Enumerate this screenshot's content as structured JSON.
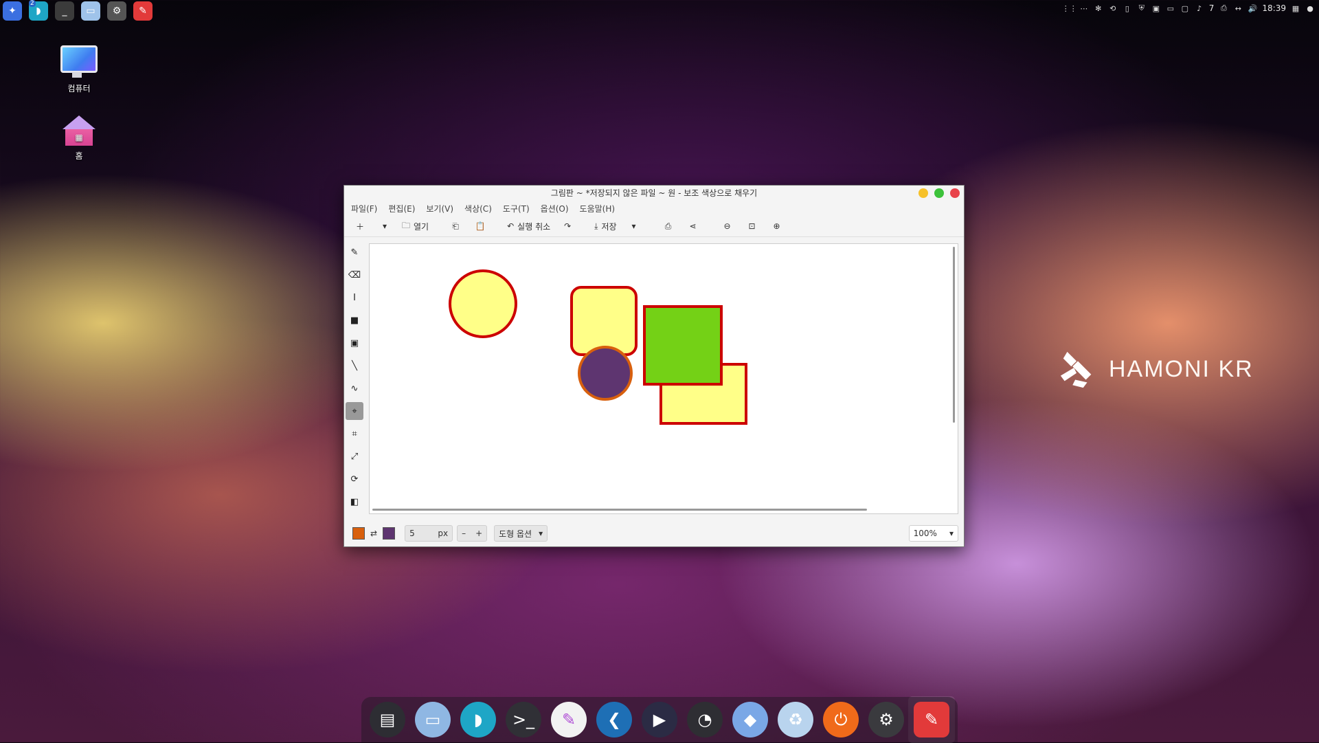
{
  "top_panel": {
    "apps": [
      {
        "name": "hamonikr-icon",
        "color": "#3b6fe0",
        "glyph": "✦"
      },
      {
        "name": "whale-browser-icon",
        "color": "#1ea6c6",
        "glyph": "◗",
        "badge": "2"
      },
      {
        "name": "terminal-icon",
        "color": "#3b3b3b",
        "glyph": "_"
      },
      {
        "name": "files-icon",
        "color": "#9fc3ea",
        "glyph": "▭"
      },
      {
        "name": "settings-icon",
        "color": "#555555",
        "glyph": "⚙"
      },
      {
        "name": "paint-icon",
        "color": "#e23a3a",
        "glyph": "✎"
      }
    ],
    "notification_count": "7",
    "clock": "18:39"
  },
  "desktop": {
    "computer_label": "컴퓨터",
    "home_label": "홈"
  },
  "brand": {
    "text": "HAMONI KR"
  },
  "window": {
    "title": "그림판 ~ *저장되지 않은 파일 ~ 원 - 보조 색상으로 채우기",
    "menu": [
      "파일(F)",
      "편집(E)",
      "보기(V)",
      "색상(C)",
      "도구(T)",
      "옵션(O)",
      "도움말(H)"
    ],
    "toolbar": {
      "open": "열기",
      "undo": "실행 취소",
      "save": "저장"
    },
    "tools": [
      {
        "name": "pencil-tool-icon",
        "glyph": "✎",
        "active": false
      },
      {
        "name": "eraser-tool-icon",
        "glyph": "⌫",
        "active": false
      },
      {
        "name": "text-tool-icon",
        "glyph": "I",
        "active": false
      },
      {
        "name": "rect-select-tool-icon",
        "glyph": "■",
        "active": false
      },
      {
        "name": "free-select-tool-icon",
        "glyph": "▣",
        "active": false
      },
      {
        "name": "line-tool-icon",
        "glyph": "╲",
        "active": false
      },
      {
        "name": "curve-tool-icon",
        "glyph": "∿",
        "active": false
      },
      {
        "name": "shape-tool-icon",
        "glyph": "⌖",
        "active": true
      },
      {
        "name": "crop-tool-icon",
        "glyph": "⌗",
        "active": false
      },
      {
        "name": "scale-tool-icon",
        "glyph": "⤢",
        "active": false
      },
      {
        "name": "rotate-tool-icon",
        "glyph": "⟳",
        "active": false
      },
      {
        "name": "filters-tool-icon",
        "glyph": "◧",
        "active": false
      }
    ],
    "bottom": {
      "main_color": "#d8600e",
      "secondary_color": "#5e3570",
      "size_value": "5",
      "size_unit": "px",
      "minus": "–",
      "plus": "+",
      "shape_options": "도형 옵션",
      "zoom": "100%"
    }
  },
  "dock": [
    {
      "name": "window-list-icon",
      "color": "#2d2d33",
      "glyph": "▤"
    },
    {
      "name": "files-icon",
      "color": "#8fb7e3",
      "glyph": "▭"
    },
    {
      "name": "whale-browser-icon",
      "color": "#1ea6c6",
      "glyph": "◗"
    },
    {
      "name": "terminal-icon",
      "color": "#303036",
      "glyph": ">_"
    },
    {
      "name": "text-editor-icon",
      "color": "#f2f2f2",
      "glyph": "✎"
    },
    {
      "name": "vscode-icon",
      "color": "#1e6fb5",
      "glyph": "❮"
    },
    {
      "name": "video-editor-icon",
      "color": "#2b2b44",
      "glyph": "▶"
    },
    {
      "name": "system-monitor-icon",
      "color": "#2e2e33",
      "glyph": "◔"
    },
    {
      "name": "software-center-icon",
      "color": "#7aa7e6",
      "glyph": "◆"
    },
    {
      "name": "trash-icon",
      "color": "#b9d4ee",
      "glyph": "♻"
    },
    {
      "name": "power-icon",
      "color": "#f06a1a",
      "glyph": "⏻"
    },
    {
      "name": "system-settings-icon",
      "color": "#3a3a3e",
      "glyph": "⚙"
    },
    {
      "name": "paint-icon",
      "color": "#e23a3a",
      "glyph": "✎"
    }
  ]
}
